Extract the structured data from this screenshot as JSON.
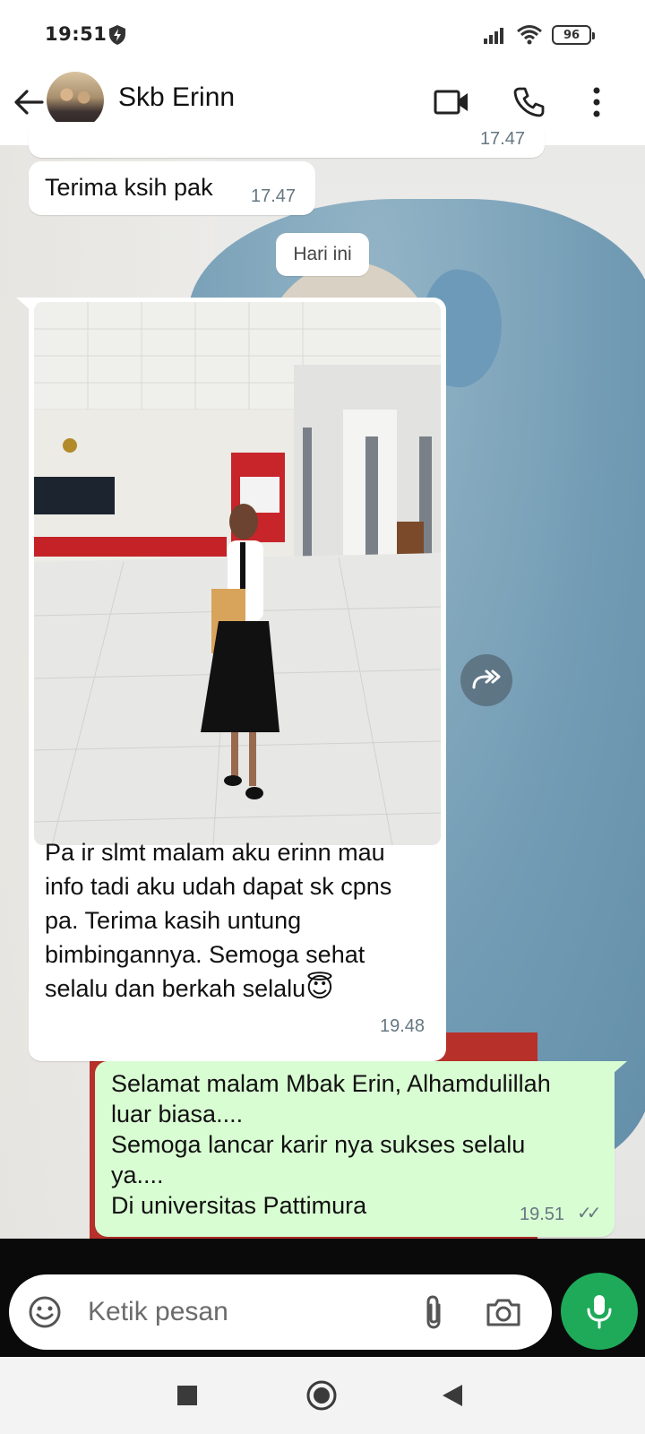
{
  "status_bar": {
    "time": "19:51",
    "battery": "96"
  },
  "header": {
    "contact_name": "Skb Erinn"
  },
  "messages": {
    "partial_time": "17.47",
    "m1": {
      "text": "Terima ksih pak",
      "time": "17.47"
    },
    "date_chip": "Hari ini",
    "m2": {
      "text": "Pa ir slmt malam aku erinn mau info tadi aku udah dapat sk cpns pa. Terima kasih untung bimbingannya. Semoga sehat selalu dan berkah selalu",
      "emoji": "😇",
      "time": "19.48"
    },
    "m3": {
      "lines": [
        "Selamat malam Mbak Erin, Alhamdulillah",
        "luar biasa....",
        "Semoga lancar karir nya sukses selalu",
        "ya....",
        "Di universitas Pattimura"
      ],
      "time": "19.51",
      "read_status": "✓✓"
    }
  },
  "composer": {
    "placeholder": "Ketik pesan"
  },
  "icons": {
    "back": "arrow-left-icon",
    "video": "video-camera-icon",
    "call": "phone-icon",
    "menu": "more-vert-icon",
    "forward": "forward-icon",
    "emoji": "emoji-icon",
    "attach": "paperclip-icon",
    "camera": "camera-icon",
    "mic": "mic-icon"
  },
  "colors": {
    "accent": "#1faa59",
    "outgoing_bubble": "#d9fdd3",
    "read_ticks": "#667781"
  }
}
